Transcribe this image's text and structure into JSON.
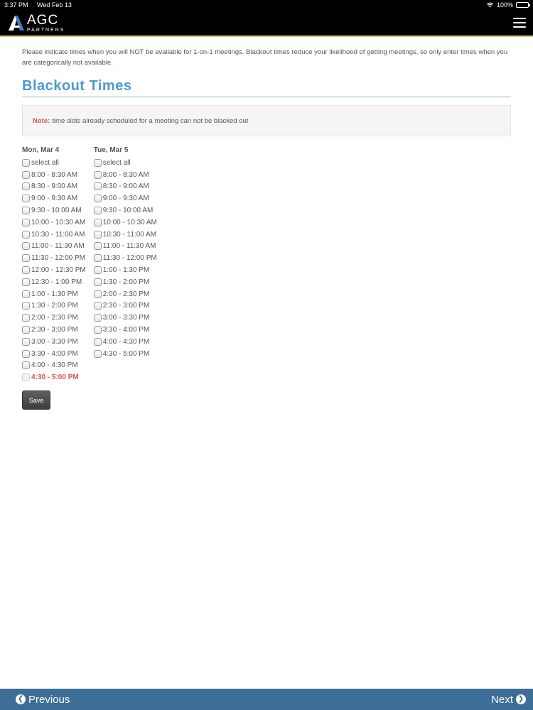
{
  "status_bar": {
    "time": "3:37 PM",
    "date": "Wed Feb 13",
    "battery": "100%"
  },
  "header": {
    "logo_text": "AGC",
    "logo_subtext": "PARTNERS",
    "menu_icon": "hamburger-menu-icon"
  },
  "intro_text": "Please indicate times when you will NOT be available for 1-on-1 meetings.   Blackout times reduce your likelihood of getting meetings, so only enter times when you are categorically not available.",
  "page_title": "Blackout Times",
  "note": {
    "label": "Note:",
    "text": "time slots already scheduled for a meeting can not be blacked out"
  },
  "days": [
    {
      "label": "Mon, Mar 4",
      "select_all": "select all",
      "slots": [
        {
          "label": "8:00 - 8:30 AM"
        },
        {
          "label": "8:30 - 9:00 AM"
        },
        {
          "label": "9:00 - 9:30 AM"
        },
        {
          "label": "9:30 - 10:00 AM"
        },
        {
          "label": "10:00 - 10:30 AM"
        },
        {
          "label": "10:30 - 11:00 AM"
        },
        {
          "label": "11:00 - 11:30 AM"
        },
        {
          "label": "11:30 - 12:00 PM"
        },
        {
          "label": "12:00 - 12:30 PM"
        },
        {
          "label": "12:30 - 1:00 PM"
        },
        {
          "label": "1:00 - 1:30 PM"
        },
        {
          "label": "1:30 - 2:00 PM"
        },
        {
          "label": "2:00 - 2:30 PM"
        },
        {
          "label": "2:30 - 3:00 PM"
        },
        {
          "label": "3:00 - 3:30 PM"
        },
        {
          "label": "3:30 - 4:00 PM"
        },
        {
          "label": "4:00 - 4:30 PM"
        },
        {
          "label": "4:30 - 5:00 PM",
          "scheduled": true
        }
      ]
    },
    {
      "label": "Tue, Mar 5",
      "select_all": "select all",
      "slots": [
        {
          "label": "8:00 - 8:30 AM"
        },
        {
          "label": "8:30 - 9:00 AM"
        },
        {
          "label": "9:00 - 9:30 AM"
        },
        {
          "label": "9:30 - 10:00 AM"
        },
        {
          "label": "10:00 - 10:30 AM"
        },
        {
          "label": "10:30 - 11:00 AM"
        },
        {
          "label": "11:00 - 11:30 AM"
        },
        {
          "label": "11:30 - 12:00 PM"
        },
        {
          "label": "1:00 - 1:30 PM"
        },
        {
          "label": "1:30 - 2:00 PM"
        },
        {
          "label": "2:00 - 2:30 PM"
        },
        {
          "label": "2:30 - 3:00 PM"
        },
        {
          "label": "3:00 - 3:30 PM"
        },
        {
          "label": "3:30 - 4:00 PM"
        },
        {
          "label": "4:00 - 4:30 PM"
        },
        {
          "label": "4:30 - 5:00 PM"
        }
      ]
    }
  ],
  "save_label": "Save",
  "nav": {
    "previous_label": "Previous",
    "next_label": "Next"
  },
  "colors": {
    "title": "#4a9cc7",
    "note_label": "#d9534f",
    "nav_bar": "#3c6e98",
    "header_bg": "#000000"
  }
}
